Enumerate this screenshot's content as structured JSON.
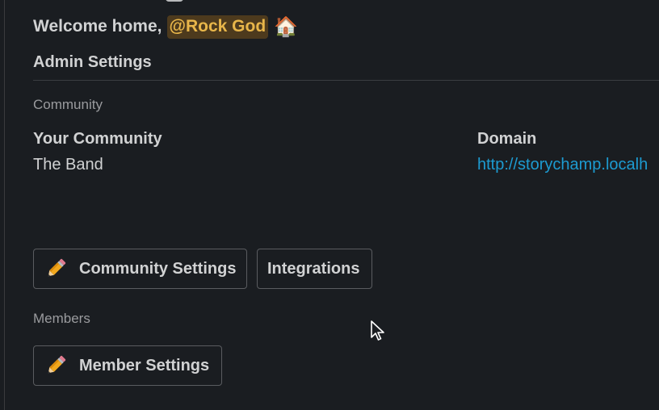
{
  "header": {
    "welcome_text": "Welcome home,",
    "mention": "@Rock God",
    "house_emoji": "🏠"
  },
  "admin": {
    "title": "Admin Settings"
  },
  "community_section": {
    "label": "Community",
    "your_community_label": "Your Community",
    "your_community_value": "The Band",
    "domain_label": "Domain",
    "domain_value": "http://storychamp.localh"
  },
  "buttons": {
    "community_settings": "Community Settings",
    "integrations": "Integrations",
    "member_settings": "Member Settings"
  },
  "members_section": {
    "label": "Members"
  },
  "icons": {
    "pencil": "pencil-icon",
    "house": "house-icon",
    "cursor": "mouse-pointer-icon"
  },
  "colors": {
    "background": "#1a1d21",
    "text": "#d1d2d3",
    "muted": "#9a9b9e",
    "mention_bg": "#4d3a1d",
    "mention_text": "#e8b64a",
    "link": "#1d9bd1",
    "border": "#5a5c60"
  }
}
